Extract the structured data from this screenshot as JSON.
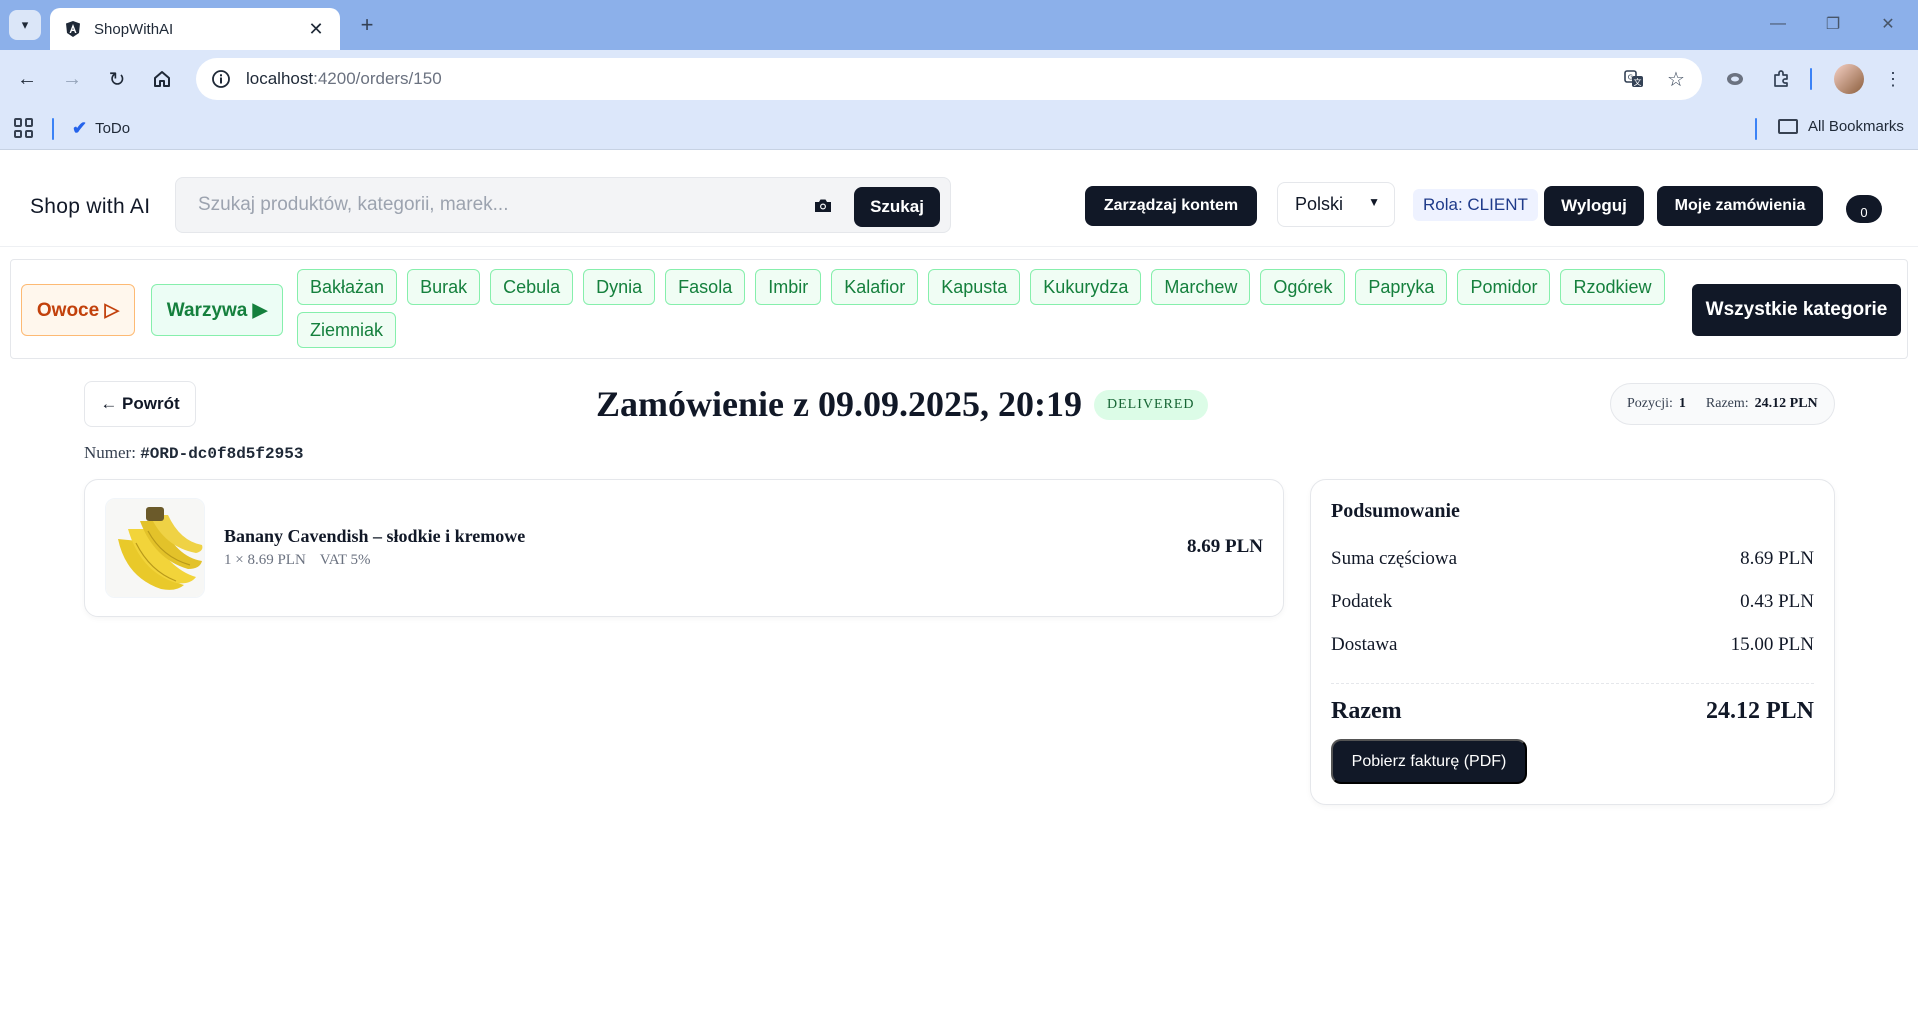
{
  "browser": {
    "tab_title": "ShopWithAI",
    "url_host": "localhost",
    "url_rest": ":4200/orders/150",
    "bookmark_todo": "ToDo",
    "all_bookmarks": "All Bookmarks"
  },
  "header": {
    "brand": "Shop with AI",
    "search_placeholder": "Szukaj produktów, kategorii, marek...",
    "search_button": "Szukaj",
    "manage_account": "Zarządzaj kontem",
    "language": "Polski",
    "role": "Rola: CLIENT",
    "logout": "Wyloguj",
    "my_orders": "Moje zamówienia",
    "cart_count": "0"
  },
  "categories": {
    "fruit": "Owoce ▷",
    "vegetables": "Warzywa ▶",
    "chips": [
      "Bakłażan",
      "Burak",
      "Cebula",
      "Dynia",
      "Fasola",
      "Imbir",
      "Kalafior",
      "Kapusta",
      "Kukurydza",
      "Marchew",
      "Ogórek",
      "Papryka",
      "Pomidor",
      "Rzodkiew",
      "Ziemniak"
    ],
    "all": "Wszystkie kategorie"
  },
  "order": {
    "back": "← Powrót",
    "title": "Zamówienie z 09.09.2025, 20:19",
    "status": "DELIVERED",
    "positions_label": "Pozycji:",
    "positions_value": "1",
    "total_label": "Razem:",
    "total_value": "24.12 PLN",
    "number_label": "Numer:",
    "number_value": "#ORD-dc0f8d5f2953",
    "items": [
      {
        "name": "Banany Cavendish – słodkie i kremowe",
        "qty_price": "1 × 8.69 PLN",
        "vat": "VAT 5%",
        "price": "8.69 PLN"
      }
    ]
  },
  "summary": {
    "title": "Podsumowanie",
    "subtotal_label": "Suma częściowa",
    "subtotal_value": "8.69 PLN",
    "tax_label": "Podatek",
    "tax_value": "0.43 PLN",
    "shipping_label": "Dostawa",
    "shipping_value": "15.00 PLN",
    "total_label": "Razem",
    "total_value": "24.12 PLN",
    "invoice_button": "Pobierz fakturę (PDF)"
  },
  "colors": {
    "dark": "#111827",
    "chip_green": "#15803d",
    "fruit_orange": "#c2410c",
    "status_green": "#dcfce7"
  }
}
